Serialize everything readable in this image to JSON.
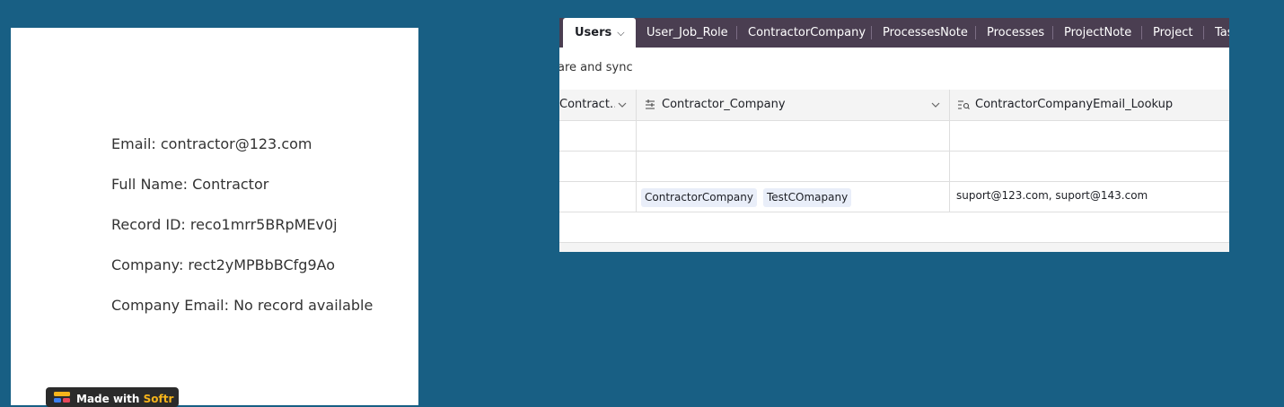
{
  "card": {
    "lines": [
      "Email: contractor@123.com",
      "Full Name: Contractor",
      "Record ID: reco1mrr5BRpMEv0j",
      "Company: rect2yMPBbBCfg9Ao",
      "Company Email: No record available"
    ],
    "badge_prefix": "Made with",
    "badge_brand": "Softr"
  },
  "panel": {
    "tabs": [
      {
        "label": "Users",
        "active": true
      },
      {
        "label": "User_Job_Role"
      },
      {
        "label": "ContractorCompany"
      },
      {
        "label": "ProcessesNote"
      },
      {
        "label": "Processes"
      },
      {
        "label": "ProjectNote"
      },
      {
        "label": "Project"
      },
      {
        "label": "Tas"
      }
    ],
    "toolbar_text": "are and sync",
    "columns": [
      {
        "label": "Contract…",
        "icon": "chevron-down-icon"
      },
      {
        "label": "Contractor_Company",
        "icon": "linked-record-icon"
      },
      {
        "label": "ContractorCompanyEmail_Lookup",
        "icon": "lookup-icon"
      }
    ],
    "rows": [
      {
        "chips": [],
        "email": ""
      },
      {
        "chips": [],
        "email": ""
      },
      {
        "chips": [
          "ContractorCompany",
          "TestCOmapany"
        ],
        "email": "suport@123.com, suport@143.com"
      },
      {
        "chips": [],
        "email": ""
      }
    ]
  },
  "colors": {
    "background": "#185f84",
    "tabbar": "#4a3e51",
    "chip": "#e9eef9",
    "brand": "#f6b41b"
  }
}
